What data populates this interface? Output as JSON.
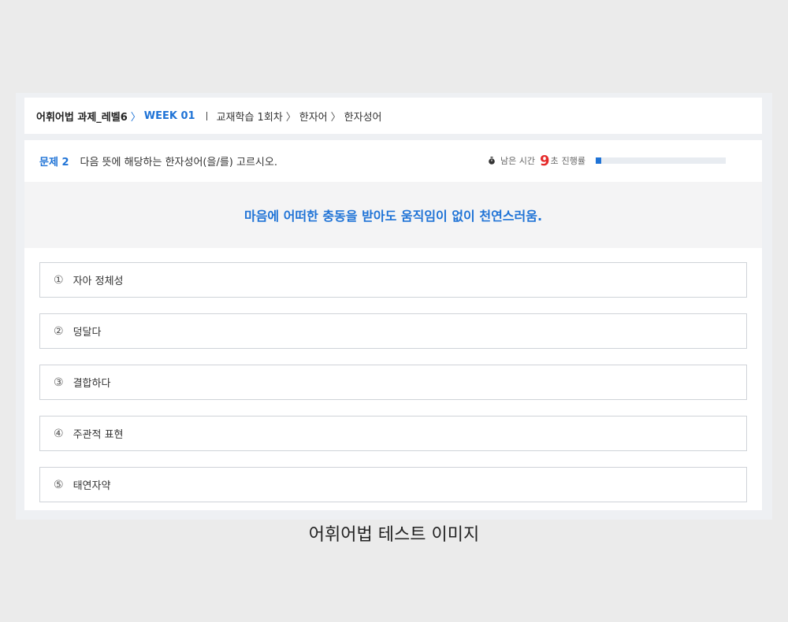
{
  "breadcrumb": {
    "course": "어휘어법 과제_레벨6",
    "week": "WEEK 01",
    "path": [
      "교재학습 1회차",
      "한자어",
      "한자성어"
    ],
    "separator": "〉"
  },
  "question": {
    "label": "문제 2",
    "prompt": "다음 뜻에 해당하는 한자성어(을/를) 고르시오.",
    "definition": "마음에 어떠한 충동을 받아도 움직임이 없이 천연스러움."
  },
  "timer": {
    "icon": "stopwatch-icon",
    "label": "남은 시간",
    "value": "9",
    "unit": "초",
    "progress_label": "진행률",
    "progress_fraction": 0.04
  },
  "choices": [
    {
      "num": "①",
      "text": "자아 정체성"
    },
    {
      "num": "②",
      "text": "덩달다"
    },
    {
      "num": "③",
      "text": "결합하다"
    },
    {
      "num": "④",
      "text": "주관적 표현"
    },
    {
      "num": "⑤",
      "text": "태연자약"
    }
  ],
  "caption": "어휘어법 테스트 이미지",
  "colors": {
    "accent": "#1f73d6",
    "timer_value": "#e52a2a",
    "definition_bg": "#f4f4f5"
  }
}
